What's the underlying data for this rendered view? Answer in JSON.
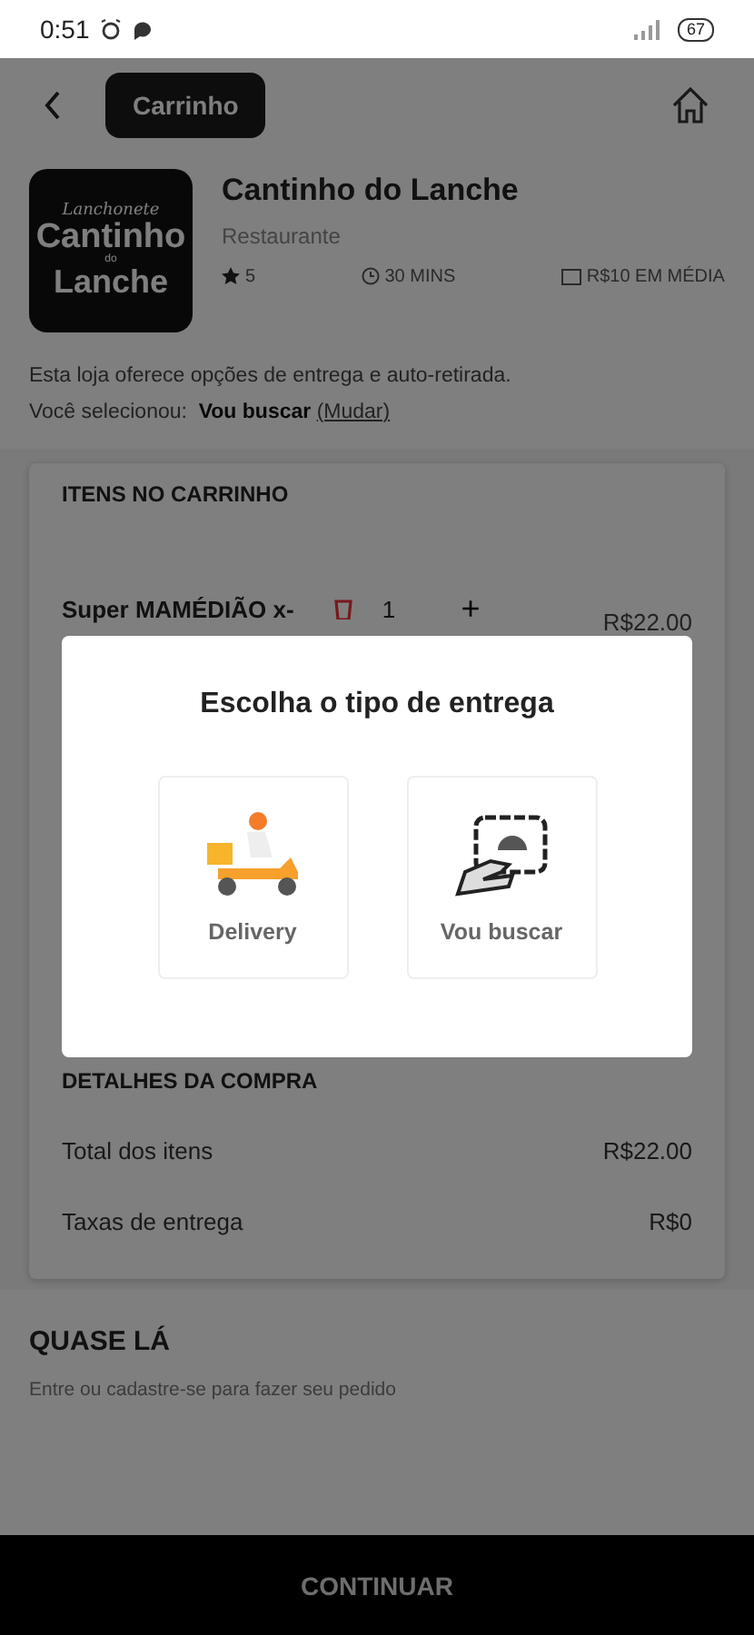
{
  "status_bar": {
    "time": "0:51",
    "battery": "67"
  },
  "header": {
    "title": "Carrinho"
  },
  "store": {
    "logo_lines": [
      "Lanchonete",
      "Cantinho",
      "do",
      "Lanche"
    ],
    "name": "Cantinho do Lanche",
    "category": "Restaurante",
    "rating": "5",
    "time": "30 MINS",
    "average": "R$10 EM MÉDIA"
  },
  "delivery_info": {
    "text": "Esta loja oferece opções de entrega e auto-retirada.",
    "selected_label": "Você selecionou:",
    "selected_value": "Vou buscar",
    "change_link": "(Mudar)"
  },
  "cart": {
    "heading": "ITENS NO CARRINHO",
    "items": [
      {
        "name": "Super MAMÉDIÃO x-",
        "quantity": "1",
        "plus": "+",
        "price": "R$22.00"
      }
    ]
  },
  "details": {
    "heading": "DETALHES DA COMPRA",
    "rows": [
      {
        "label": "Total dos itens",
        "value": "R$22.00"
      },
      {
        "label": "Taxas de entrega",
        "value": "R$0"
      }
    ]
  },
  "almost": {
    "title": "QUASE LÁ",
    "subtitle": "Entre ou cadastre-se para fazer seu pedido"
  },
  "continue_button": "CONTINUAR",
  "dialog": {
    "title": "Escolha o tipo de entrega",
    "options": [
      {
        "kind": "delivery",
        "label": "Delivery"
      },
      {
        "kind": "pickup",
        "label": "Vou buscar"
      }
    ]
  }
}
